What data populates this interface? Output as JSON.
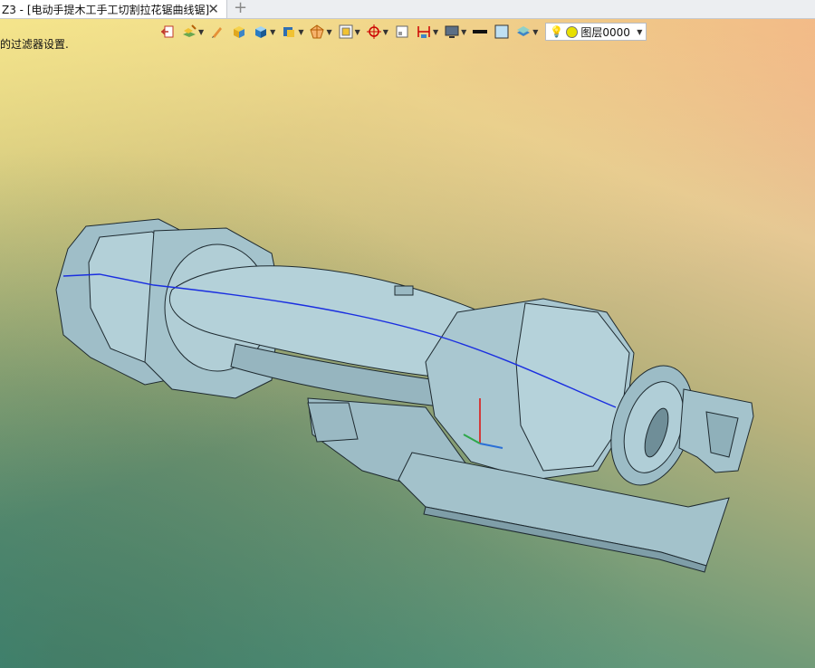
{
  "tab": {
    "title": "Z3 - [电动手提木工手工切割拉花锯曲线锯]",
    "close_icon": "close-icon",
    "add_icon": "plus-icon"
  },
  "hint": {
    "text": "的过滤器设置."
  },
  "toolbar": {
    "items": [
      "exit-sketch-icon",
      "layers-icon",
      "pen-icon",
      "solid-icon",
      "cube-icon",
      "view-cube-icon",
      "render-mode-icon",
      "grid-snap-icon",
      "target-icon",
      "frame-icon",
      "dimension-icon",
      "monitor-icon",
      "line-color-icon",
      "fill-color-icon",
      "layer-stack-icon"
    ],
    "layer": {
      "name": "图层0000",
      "light_icon": "lightbulb-icon",
      "color": "#e8e000"
    }
  },
  "colors": {
    "model_fill": "#a8c6cf",
    "model_edge": "#1e2a30",
    "accent_curve": "#1a2ee0"
  }
}
